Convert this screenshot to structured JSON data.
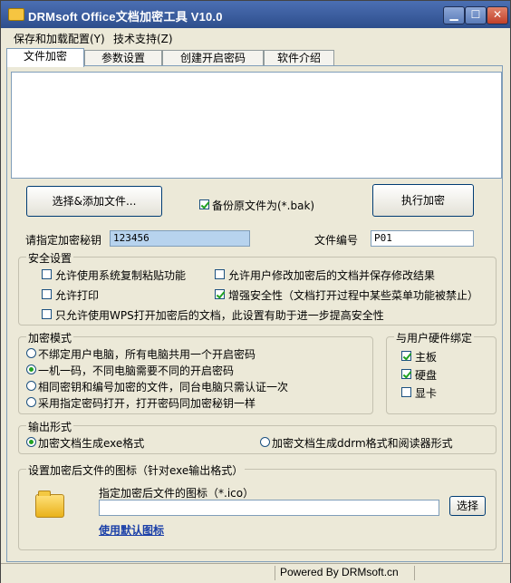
{
  "window": {
    "title": "DRMsoft Office文档加密工具 V10.0",
    "min_glyph": "▁",
    "max_glyph": "☐",
    "close_glyph": "✕"
  },
  "menu": {
    "items": [
      "保存和加载配置(Y)",
      "技术支持(Z)"
    ]
  },
  "tabs": [
    "文件加密",
    "参数设置",
    "创建开启密码",
    "软件介绍"
  ],
  "actions": {
    "select_add": "选择&添加文件...",
    "backup_label": "备份原文件为(*.bak)",
    "backup_checked": true,
    "execute": "执行加密"
  },
  "key": {
    "label": "请指定加密秘钥",
    "value": "123456",
    "file_no_label": "文件编号",
    "file_no_value": "P01"
  },
  "security": {
    "title": "安全设置",
    "opt1": "允许使用系统复制粘贴功能",
    "opt2": "允许用户修改加密后的文档并保存修改结果",
    "opt3": "允许打印",
    "opt4": "增强安全性（文档打开过程中某些菜单功能被禁止）",
    "opt5": "只允许使用WPS打开加密后的文档，此设置有助于进一步提高安全性"
  },
  "mode": {
    "title": "加密模式",
    "opt1": "不绑定用户电脑，所有电脑共用一个开启密码",
    "opt2": "一机一码，不同电脑需要不同的开启密码",
    "opt3": "相同密钥和编号加密的文件，同台电脑只需认证一次",
    "opt4": "采用指定密码打开，打开密码同加密秘钥一样"
  },
  "hardware": {
    "title": "与用户硬件绑定",
    "opt1": "主板",
    "opt2": "硬盘",
    "opt3": "显卡"
  },
  "output": {
    "title": "输出形式",
    "opt1": "加密文档生成exe格式",
    "opt2": "加密文档生成ddrm格式和阅读器形式"
  },
  "icon_section": {
    "title": "设置加密后文件的图标（针对exe输出格式）",
    "field_label": "指定加密后文件的图标（*.ico）",
    "field_value": "",
    "select_btn": "选择",
    "default_link": "使用默认图标"
  },
  "status": {
    "text": "Powered By DRMsoft.cn"
  }
}
